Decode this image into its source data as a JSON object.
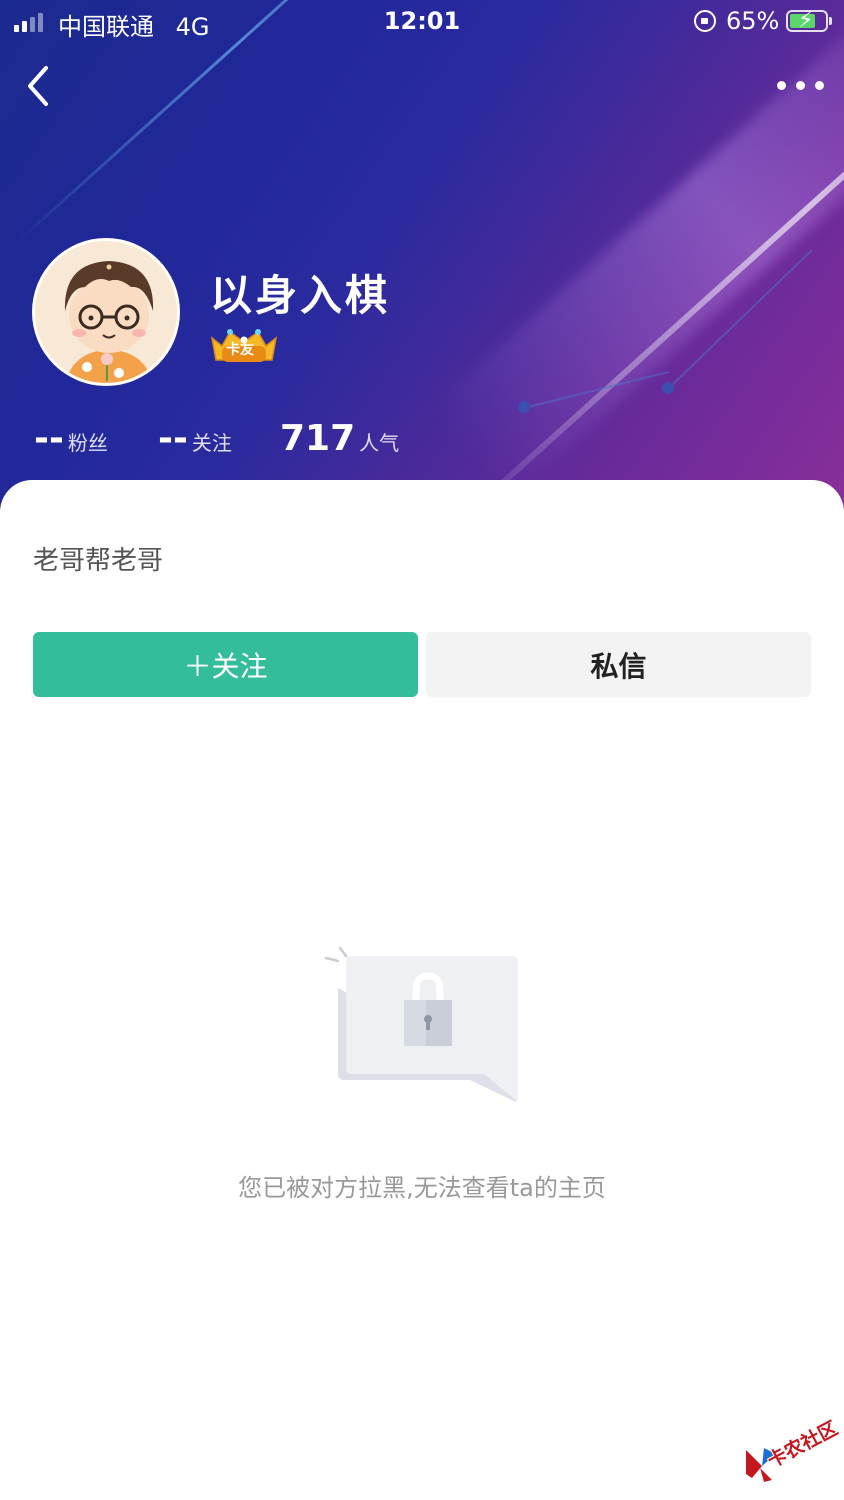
{
  "status_bar": {
    "carrier": "中国联通",
    "network": "4G",
    "time": "12:01",
    "battery_percent": "65%",
    "battery_level": 0.65
  },
  "header": {
    "back_icon": "chevron-left-icon",
    "more_icon": "more-dots-icon"
  },
  "profile": {
    "username": "以身入棋",
    "badge_text": "卡友",
    "stats": [
      {
        "value": "--",
        "label": "粉丝"
      },
      {
        "value": "--",
        "label": "关注"
      },
      {
        "value": "717",
        "label": "人气"
      }
    ],
    "bio": "老哥帮老哥"
  },
  "actions": {
    "follow_label": "＋关注",
    "message_label": "私信"
  },
  "empty_state": {
    "icon": "locked-message-icon",
    "message": "您已被对方拉黑,无法查看ta的主页"
  },
  "watermark": {
    "text": "卡农社区"
  },
  "colors": {
    "accent": "#33bd9b",
    "brand_red": "#c4181f",
    "badge_gold": "#f5b826"
  }
}
